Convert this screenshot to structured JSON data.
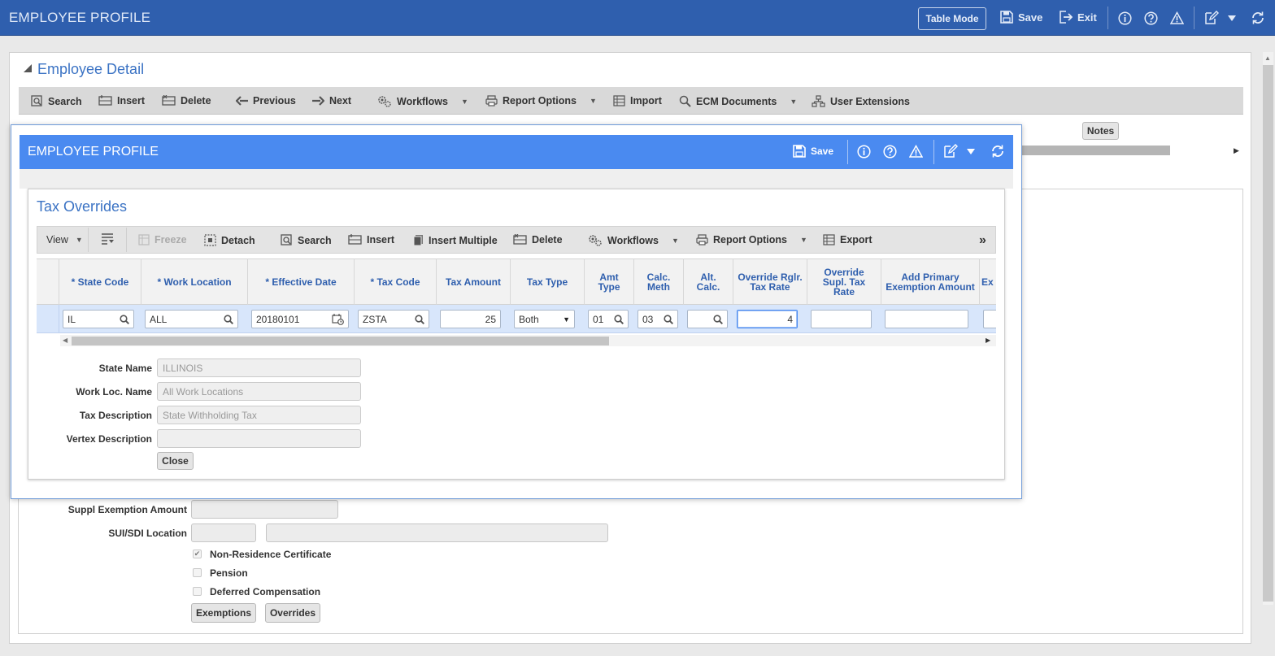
{
  "app": {
    "title": "EMPLOYEE PROFILE",
    "table_mode_label": "Table Mode",
    "save_label": "Save",
    "exit_label": "Exit"
  },
  "background": {
    "section_title": "Employee Detail",
    "toolbar": {
      "search": "Search",
      "insert": "Insert",
      "delete": "Delete",
      "previous": "Previous",
      "next": "Next",
      "workflows": "Workflows",
      "report_options": "Report Options",
      "import": "Import",
      "ecm_documents": "ECM Documents",
      "user_extensions": "User Extensions"
    },
    "notes_label": "Notes",
    "form": {
      "suppl_exemption_label": "Suppl Exemption Amount",
      "sui_sdi_label": "SUI/SDI Location",
      "non_residence_label": "Non-Residence Certificate",
      "pension_label": "Pension",
      "deferred_comp_label": "Deferred Compensation",
      "exemptions_button": "Exemptions",
      "overrides_button": "Overrides"
    }
  },
  "modal": {
    "title": "EMPLOYEE PROFILE",
    "save_label": "Save",
    "panel_title": "Tax Overrides",
    "toolbar": {
      "view": "View",
      "freeze": "Freeze",
      "detach": "Detach",
      "search": "Search",
      "insert": "Insert",
      "insert_multiple": "Insert Multiple",
      "delete": "Delete",
      "workflows": "Workflows",
      "report_options": "Report Options",
      "export": "Export"
    },
    "columns": {
      "state_code": "* State Code",
      "work_location": "* Work Location",
      "effective_date": "* Effective Date",
      "tax_code": "* Tax Code",
      "tax_amount": "Tax Amount",
      "tax_type": "Tax Type",
      "amt_type": "Amt Type",
      "calc_meth": "Calc. Meth",
      "alt_calc": "Alt. Calc.",
      "override_rglr": "Override Rglr. Tax Rate",
      "override_supl": "Override Supl. Tax Rate",
      "add_primary": "Add Primary Exemption Amount",
      "ex": "Ex"
    },
    "row": {
      "state_code": "IL",
      "work_location": "ALL",
      "effective_date": "20180101",
      "tax_code": "ZSTA",
      "tax_amount": "25",
      "tax_type": "Both",
      "amt_type": "01",
      "calc_meth": "03",
      "alt_calc": "",
      "override_rglr": "4",
      "override_supl": "",
      "add_primary": ""
    },
    "detail": {
      "state_name_label": "State Name",
      "state_name_value": "ILLINOIS",
      "work_loc_name_label": "Work Loc. Name",
      "work_loc_name_value": "All Work Locations",
      "tax_desc_label": "Tax Description",
      "tax_desc_value": "State Withholding Tax",
      "vertex_desc_label": "Vertex Description",
      "vertex_desc_value": "",
      "close_button": "Close"
    }
  },
  "colors": {
    "header_blue": "#2f5fae",
    "modal_blue": "#4a8af0",
    "title_blue": "#3b73c4",
    "row_selected": "#d8e6fb"
  }
}
